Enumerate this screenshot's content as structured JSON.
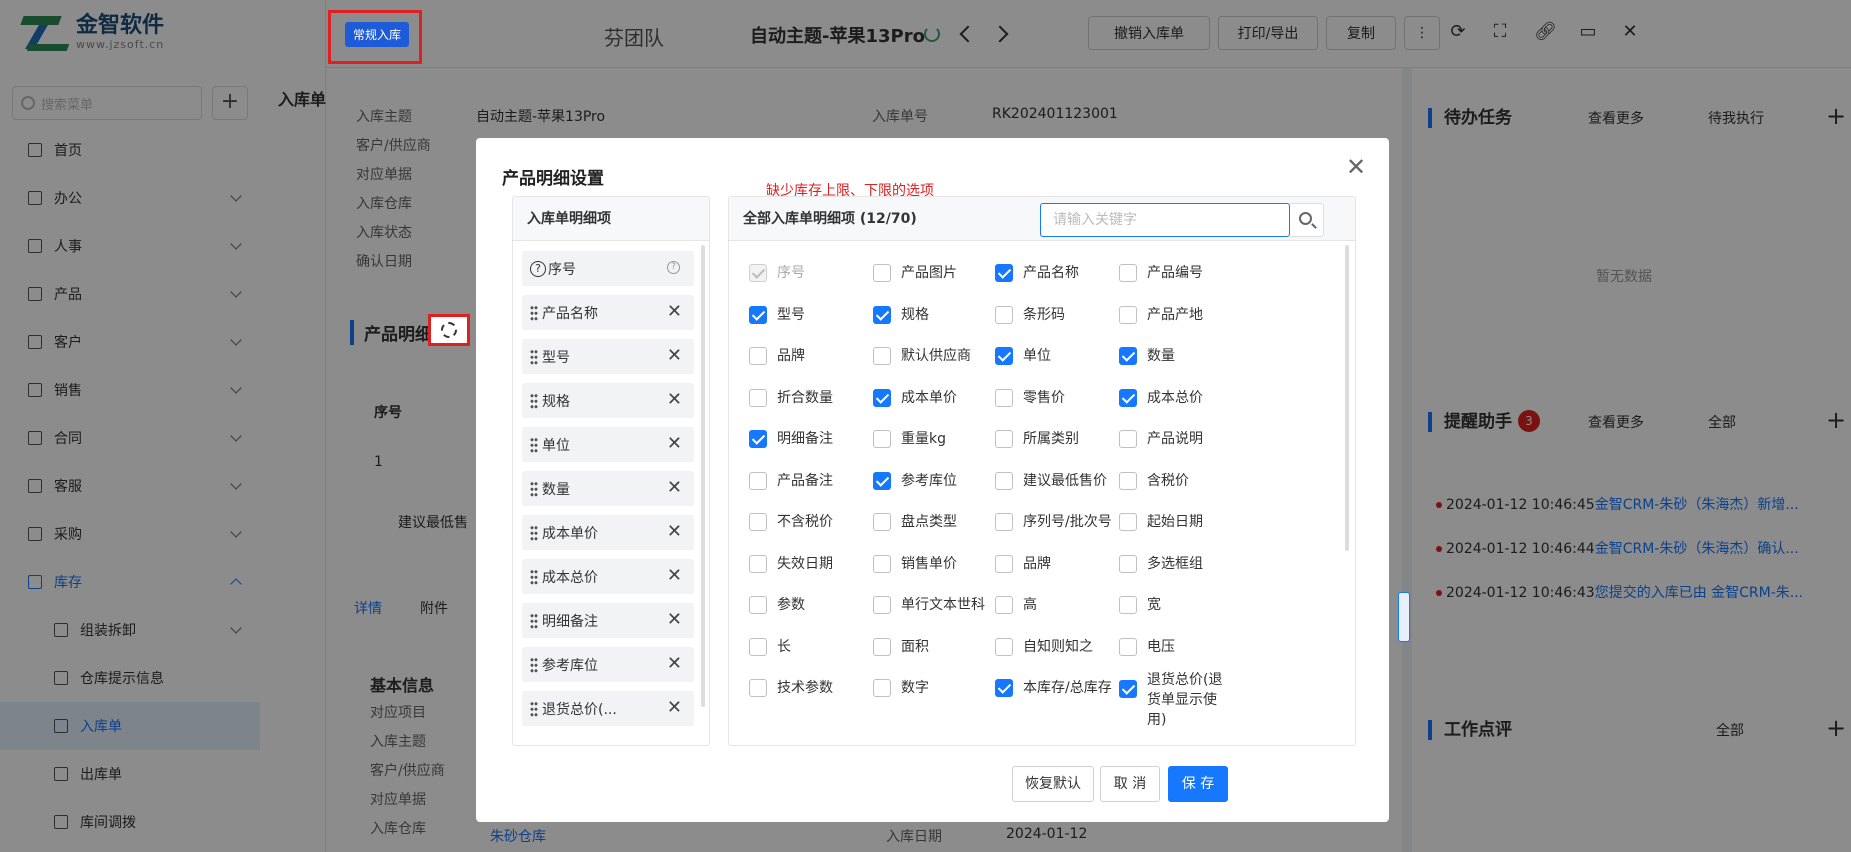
{
  "brand": {
    "name": "金智软件",
    "url": "www.jzsoft.cn"
  },
  "sidebar": {
    "search_placeholder": "搜索菜单",
    "items": [
      {
        "label": "首页",
        "chev": false
      },
      {
        "label": "办公",
        "chev": true
      },
      {
        "label": "人事",
        "chev": true
      },
      {
        "label": "产品",
        "chev": true
      },
      {
        "label": "客户",
        "chev": true
      },
      {
        "label": "销售",
        "chev": true
      },
      {
        "label": "合同",
        "chev": true
      },
      {
        "label": "客服",
        "chev": true
      },
      {
        "label": "采购",
        "chev": true
      },
      {
        "label": "库存",
        "chev": true
      },
      {
        "label": "组装拆卸",
        "chev": true
      },
      {
        "label": "仓库提示信息",
        "chev": false
      },
      {
        "label": "入库单",
        "chev": false
      },
      {
        "label": "出库单",
        "chev": false
      },
      {
        "label": "库间调拨",
        "chev": false
      }
    ]
  },
  "topbar": {
    "crumb": "芬团队",
    "tag": "常规入库",
    "title": "自动主题-苹果13Pro",
    "buttons": [
      "撤销入库单",
      "打印/导出",
      "复制"
    ],
    "icons": [
      "more-icon",
      "refresh-icon",
      "fullscreen-icon",
      "link-icon",
      "laptop-icon",
      "close-icon"
    ]
  },
  "main": {
    "tab_label": "入库单",
    "fields": [
      {
        "label": "入库主题",
        "value": "自动主题-苹果13Pro"
      },
      {
        "label": "客户/供应商",
        "value": ""
      },
      {
        "label": "对应单据",
        "value": ""
      },
      {
        "label": "入库仓库",
        "value": ""
      },
      {
        "label": "入库状态",
        "value": ""
      },
      {
        "label": "确认日期",
        "value": ""
      }
    ],
    "doc_no_label": "入库单号",
    "doc_no_value": "RK202401123001",
    "section_title": "产品明细",
    "table_head": "序号",
    "table_row1": "1",
    "bottom_label": "建议最低售",
    "tabs": [
      "详情",
      "附件"
    ],
    "basic_title": "基本信息",
    "basic_fields": [
      "对应项目",
      "入库主题",
      "客户/供应商",
      "对应单据",
      "入库仓库"
    ],
    "warehouse_value": "朱砂仓库",
    "date_label": "入库日期",
    "date_value": "2024-01-12"
  },
  "right_panel": {
    "todo_title": "待办任务",
    "todo_more": "查看更多",
    "todo_filter": "待我执行",
    "todo_empty": "暂无数据",
    "remind_title": "提醒助手",
    "remind_badge": "3",
    "remind_more": "查看更多",
    "remind_filter": "全部",
    "reminders": [
      {
        "time": "2024-01-12 10:46:45",
        "text": "金智CRM-朱砂（朱海杰）新增..."
      },
      {
        "time": "2024-01-12 10:46:44",
        "text": "金智CRM-朱砂（朱海杰）确认..."
      },
      {
        "time": "2024-01-12 10:46:43",
        "text": "您提交的入库已由 金智CRM-朱..."
      }
    ],
    "review_title": "工作点评",
    "review_filter": "全部"
  },
  "modal": {
    "title": "产品明细设置",
    "note": "缺少库存上限、下限的选项",
    "left_title": "入库单明细项",
    "selected": [
      "序号",
      "产品名称",
      "型号",
      "规格",
      "单位",
      "数量",
      "成本单价",
      "成本总价",
      "明细备注",
      "参考库位",
      "退货总价(..."
    ],
    "right_title": "全部入库单明细项 (12/70)",
    "search_placeholder": "请输入关键字",
    "options": [
      {
        "label": "序号",
        "checked": true,
        "disabled": true
      },
      {
        "label": "产品图片",
        "checked": false
      },
      {
        "label": "产品名称",
        "checked": true
      },
      {
        "label": "产品编号",
        "checked": false
      },
      {
        "label": "型号",
        "checked": true
      },
      {
        "label": "规格",
        "checked": true
      },
      {
        "label": "条形码",
        "checked": false
      },
      {
        "label": "产品产地",
        "checked": false
      },
      {
        "label": "品牌",
        "checked": false
      },
      {
        "label": "默认供应商",
        "checked": false
      },
      {
        "label": "单位",
        "checked": true
      },
      {
        "label": "数量",
        "checked": true
      },
      {
        "label": "折合数量",
        "checked": false
      },
      {
        "label": "成本单价",
        "checked": true
      },
      {
        "label": "零售价",
        "checked": false
      },
      {
        "label": "成本总价",
        "checked": true
      },
      {
        "label": "明细备注",
        "checked": true
      },
      {
        "label": "重量kg",
        "checked": false
      },
      {
        "label": "所属类别",
        "checked": false
      },
      {
        "label": "产品说明",
        "checked": false
      },
      {
        "label": "产品备注",
        "checked": false
      },
      {
        "label": "参考库位",
        "checked": true
      },
      {
        "label": "建议最低售价",
        "checked": false
      },
      {
        "label": "含税价",
        "checked": false
      },
      {
        "label": "不含税价",
        "checked": false
      },
      {
        "label": "盘点类型",
        "checked": false
      },
      {
        "label": "序列号/批次号",
        "checked": false
      },
      {
        "label": "起始日期",
        "checked": false
      },
      {
        "label": "失效日期",
        "checked": false
      },
      {
        "label": "销售单价",
        "checked": false
      },
      {
        "label": "品牌",
        "checked": false
      },
      {
        "label": "多选框组",
        "checked": false
      },
      {
        "label": "参数",
        "checked": false
      },
      {
        "label": "单行文本世科",
        "checked": false
      },
      {
        "label": "高",
        "checked": false
      },
      {
        "label": "宽",
        "checked": false
      },
      {
        "label": "长",
        "checked": false
      },
      {
        "label": "面积",
        "checked": false
      },
      {
        "label": "自知则知之",
        "checked": false
      },
      {
        "label": "电压",
        "checked": false
      },
      {
        "label": "技术参数",
        "checked": false
      },
      {
        "label": "数字",
        "checked": false
      },
      {
        "label": "本库存/总库存",
        "checked": true
      },
      {
        "label": "退货总价(退货单显示使用)",
        "checked": true
      }
    ],
    "btn_reset": "恢复默认",
    "btn_cancel": "取 消",
    "btn_save": "保 存"
  },
  "colors": {
    "accent": "#1677ff",
    "highlight": "#e02020"
  }
}
